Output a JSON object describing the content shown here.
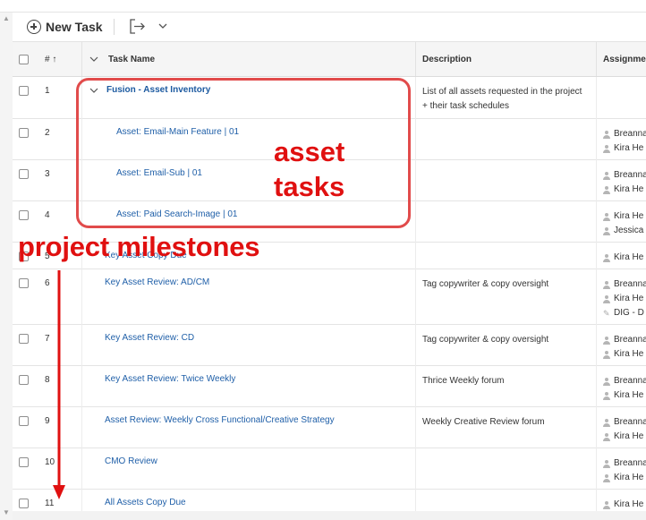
{
  "toolbar": {
    "new_task_label": "New Task"
  },
  "columns": {
    "number": "#",
    "sort_glyph": "↑",
    "task_name": "Task Name",
    "description": "Description",
    "assignments": "Assignmen"
  },
  "rows": [
    {
      "num": "1",
      "name": "Fusion - Asset Inventory",
      "desc": "List of all assets requested in the project + their task schedules",
      "assignees": []
    },
    {
      "num": "2",
      "name": "Asset: Email-Main Feature | 01",
      "desc": "",
      "assignees": [
        "Breanna",
        "Kira He"
      ]
    },
    {
      "num": "3",
      "name": "Asset: Email-Sub | 01",
      "desc": "",
      "assignees": [
        "Breanna",
        "Kira He"
      ]
    },
    {
      "num": "4",
      "name": "Asset: Paid Search-Image | 01",
      "desc": "",
      "assignees": [
        "Kira He",
        "Jessica"
      ]
    },
    {
      "num": "5",
      "name": "Key Asset Copy Due",
      "desc": "",
      "assignees": [
        "Kira He"
      ]
    },
    {
      "num": "6",
      "name": "Key Asset Review: AD/CM",
      "desc": "Tag copywriter & copy oversight",
      "assignees": [
        "Breanna",
        "Kira He",
        "DIG - D"
      ]
    },
    {
      "num": "7",
      "name": "Key Asset Review: CD",
      "desc": "Tag copywriter & copy oversight",
      "assignees": [
        "Breanna",
        "Kira He"
      ]
    },
    {
      "num": "8",
      "name": "Key Asset Review: Twice Weekly",
      "desc": "Thrice Weekly forum",
      "assignees": [
        "Breanna",
        "Kira He"
      ]
    },
    {
      "num": "9",
      "name": "Asset Review: Weekly Cross Functional/Creative Strategy",
      "desc": "Weekly Creative Review forum",
      "assignees": [
        "Breanna",
        "Kira He"
      ]
    },
    {
      "num": "10",
      "name": "CMO Review",
      "desc": "",
      "assignees": [
        "Breanna",
        "Kira He"
      ]
    },
    {
      "num": "11",
      "name": "All Assets Copy Due",
      "desc": "",
      "assignees": [
        "Kira He"
      ]
    }
  ],
  "annotations": {
    "asset_tasks": [
      "asset",
      "tasks"
    ],
    "project_milestones": "project milestones",
    "color": "#e01010"
  }
}
